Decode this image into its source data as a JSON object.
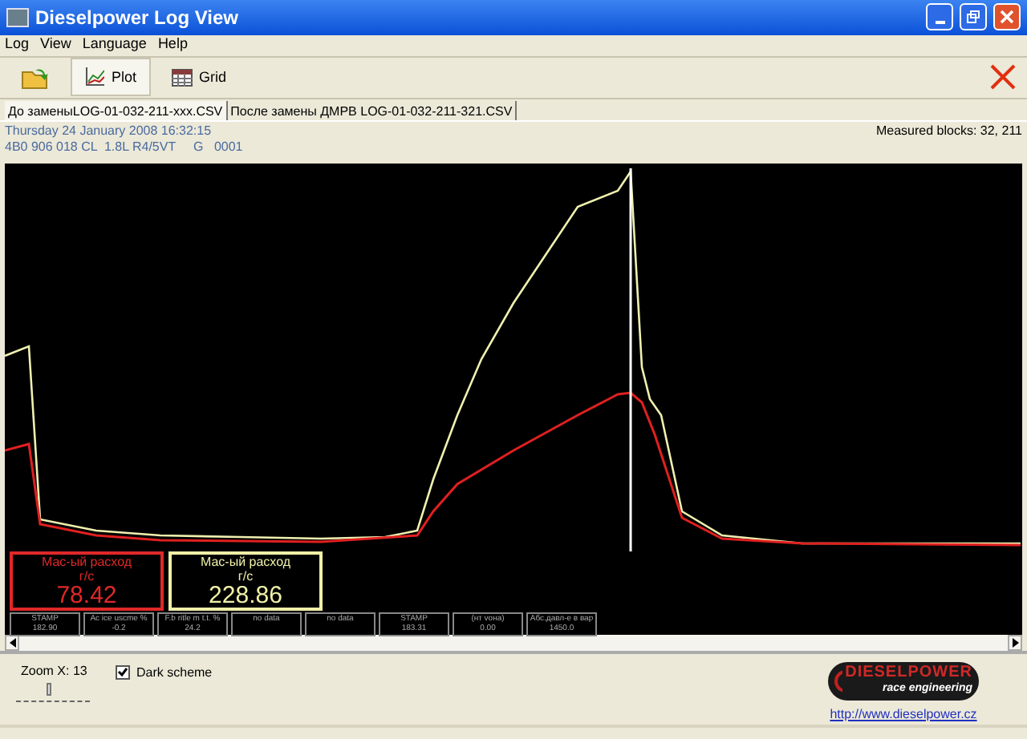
{
  "window": {
    "title": "Dieselpower Log View"
  },
  "menu": [
    "Log",
    "View",
    "Language",
    "Help"
  ],
  "toolbar": [
    {
      "kind": "open",
      "selected": false
    },
    {
      "kind": "plot",
      "label": "Plot",
      "selected": true
    },
    {
      "kind": "grid",
      "label": "Grid",
      "selected": false
    }
  ],
  "file_tabs": [
    {
      "label": "До заменыLOG-01-032-211-xxx.CSV",
      "selected": true
    },
    {
      "label": "После замены ДМРВ LOG-01-032-211-321.CSV",
      "selected": false
    }
  ],
  "info": {
    "date": "Thursday 24 January 2008 16:32:15",
    "vehicle": "4B0 906 018 CL  1.8L R4/5VT     G   0001",
    "measured_blocks": "Measured blocks: 32, 211"
  },
  "value_boxes": [
    {
      "label": "Мас-ый расход",
      "unit": "г/с",
      "value": "78.42",
      "color": "#e02828"
    },
    {
      "label": "Мас-ый расход",
      "unit": "г/с",
      "value": "228.86",
      "color": "#f0f0a8"
    }
  ],
  "channels": [
    {
      "name": "STAMP",
      "value": "182.90"
    },
    {
      "name": "Ac ice uscme %",
      "value": "-0.2"
    },
    {
      "name": "F.b ritle m t.t. %",
      "value": "24.2"
    },
    {
      "name": "no data"
    },
    {
      "name": "no data"
    },
    {
      "name": "STAMP",
      "value": "183.31"
    },
    {
      "name": "(нт voна)",
      "value": "0.00"
    },
    {
      "name": "Абс.давл-е в  вар",
      "value": "1450.0"
    }
  ],
  "zoom": {
    "label": "Zoom X: 13",
    "level": 0.45
  },
  "dark_scheme": {
    "label": "Dark scheme",
    "checked": true
  },
  "logo": {
    "name": "DIESELPOWER",
    "tagline": "race engineering"
  },
  "link": "http://www.dieselpower.cz"
}
